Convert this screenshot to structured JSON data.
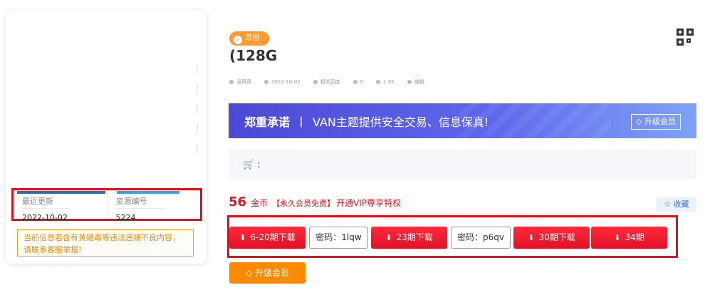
{
  "left_card": {
    "meta": [
      {
        "label": "最近更新",
        "value": "2022-10-02"
      },
      {
        "label": "资源编号",
        "value": "5224"
      }
    ],
    "warning": "当前信息若含有黄赌毒等违法违规不良内容，请联系客服举报!"
  },
  "header": {
    "tag_label": "原创",
    "title": "(128G",
    "info": [
      "温哥哥",
      "2022-10-02",
      "相关百度",
      "0",
      "1.6K",
      "编辑"
    ]
  },
  "banner": {
    "strong_text": "郑重承诺",
    "separator": "丨",
    "text": "VAN主题提供安全交易、信息保真!",
    "vip_button": "升级会员"
  },
  "cart": {
    "label": ":"
  },
  "price": {
    "amount": "56",
    "unit": "金币",
    "free_text": "【永久会员免费】",
    "vip_link": "开通VIP尊享特权",
    "favorite": "收藏"
  },
  "downloads": {
    "btn1": "6-20期下载",
    "pw1": "密码：1lqw",
    "btn2": "23期下载",
    "pw2": "密码：p6qv",
    "btn3": "30期下载",
    "btn4": "34期"
  },
  "upgrade_button": "升级会员",
  "colors": {
    "accent_red": "#e4141f",
    "banner_blue": "#4b49d6",
    "orange": "#ff8a00"
  }
}
